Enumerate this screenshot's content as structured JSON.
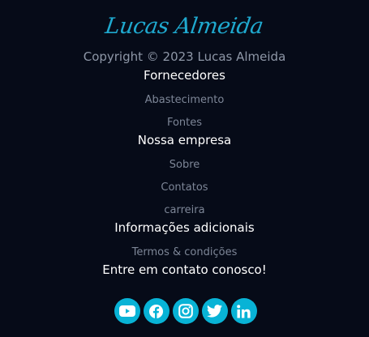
{
  "logo": {
    "text": "Lucas Almeida",
    "color": "#1fa9cf"
  },
  "copyright": "Copyright © 2023 Lucas Almeida",
  "sections": [
    {
      "heading": "Fornecedores",
      "links": [
        "Abastecimento",
        "Fontes"
      ]
    },
    {
      "heading": "Nossa empresa",
      "links": [
        "Sobre",
        "Contatos",
        "carreira"
      ]
    },
    {
      "heading": "Informações adicionais",
      "links": [
        "Termos & condições"
      ]
    }
  ],
  "contact_heading": "Entre em contato conosco!",
  "social": {
    "accent": "#08b3d6",
    "icons": [
      "youtube-icon",
      "facebook-icon",
      "instagram-icon",
      "twitter-icon",
      "linkedin-icon"
    ]
  },
  "colors": {
    "background": "#060b18",
    "heading": "#ffffff",
    "link": "#7d8697"
  }
}
